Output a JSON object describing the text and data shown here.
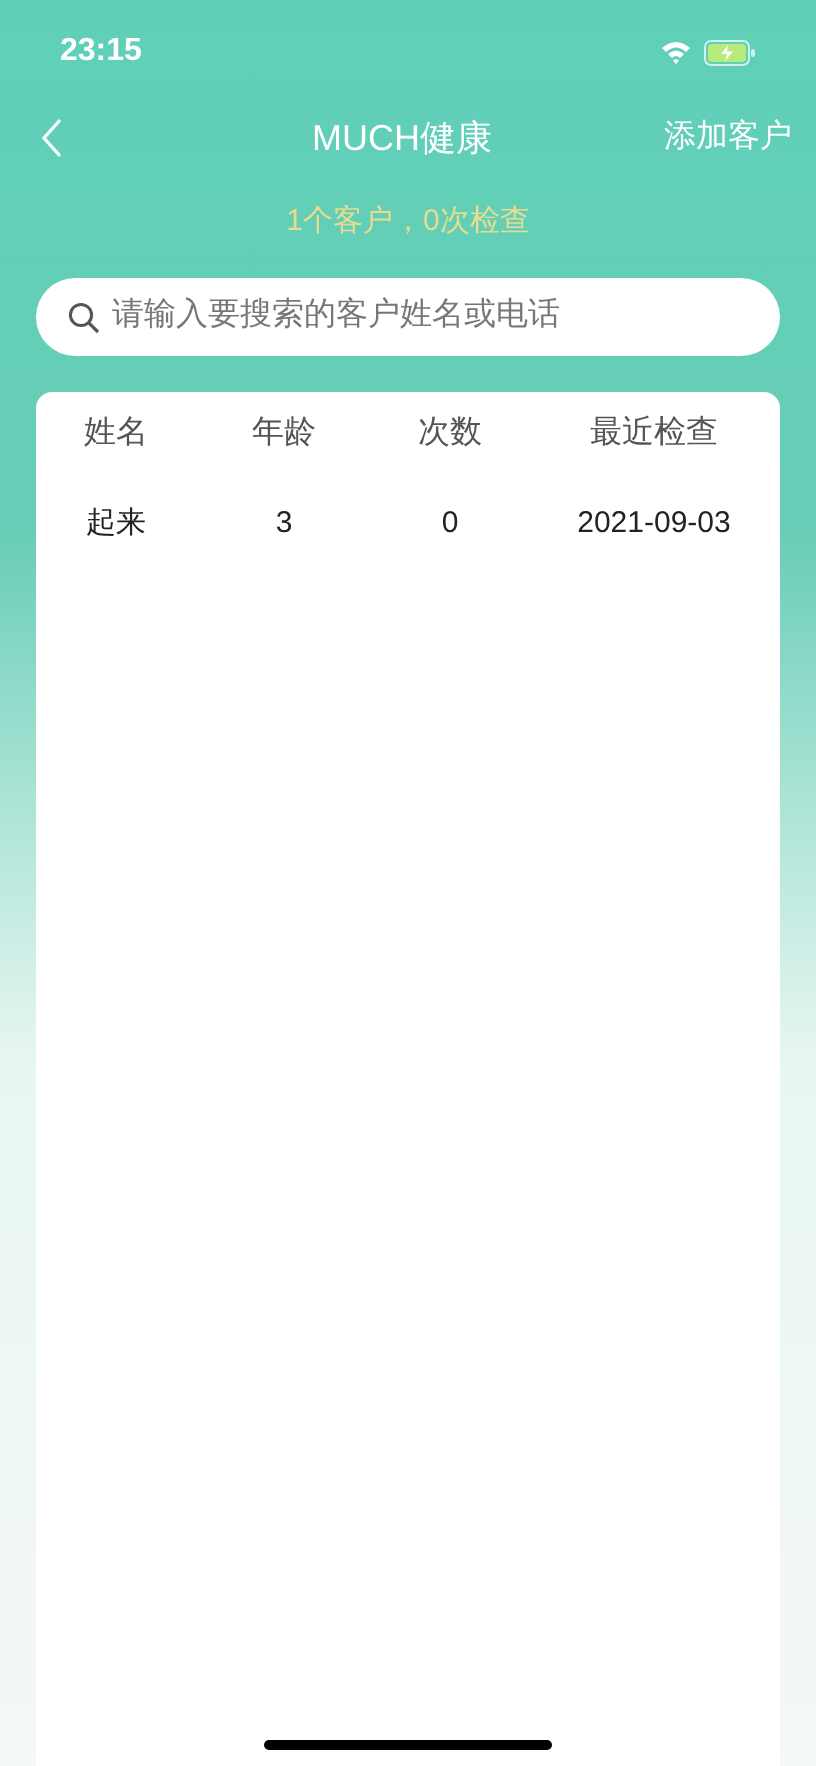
{
  "status_bar": {
    "time": "23:15"
  },
  "nav": {
    "title": "MUCH健康",
    "action": "添加客户"
  },
  "summary": "1个客户，0次检查",
  "search": {
    "placeholder": "请输入要搜索的客户姓名或电话"
  },
  "table": {
    "columns": [
      "姓名",
      "年龄",
      "次数",
      "最近检查"
    ],
    "rows": [
      [
        "起来",
        "3",
        "0",
        "2021-09-03"
      ]
    ]
  }
}
